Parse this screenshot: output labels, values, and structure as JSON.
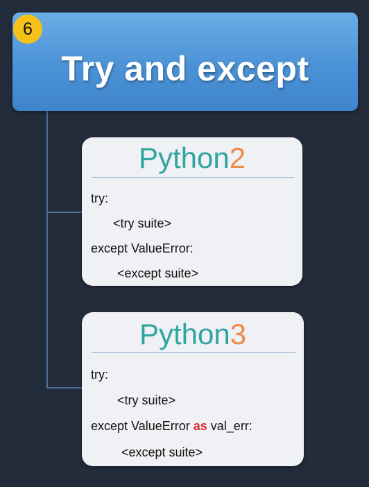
{
  "header": {
    "badge": "6",
    "title": "Try and except"
  },
  "cards": [
    {
      "title_base": "Python",
      "title_version": "2",
      "lines": [
        "try:",
        "<try suite>",
        "except ValueError:",
        "<except suite>"
      ]
    },
    {
      "title_base": "Python",
      "title_version": "3",
      "lines": [
        "try:",
        "<try suite>",
        "except ValueError ",
        "as",
        " val_err:",
        "<except suite>"
      ]
    }
  ],
  "colors": {
    "background": "#232c3b",
    "header": "#4b92d6",
    "badge": "#f6c21a",
    "title_teal": "#2fa5a0",
    "title_orange": "#ec8a4a",
    "keyword_red": "#d42a2a"
  }
}
